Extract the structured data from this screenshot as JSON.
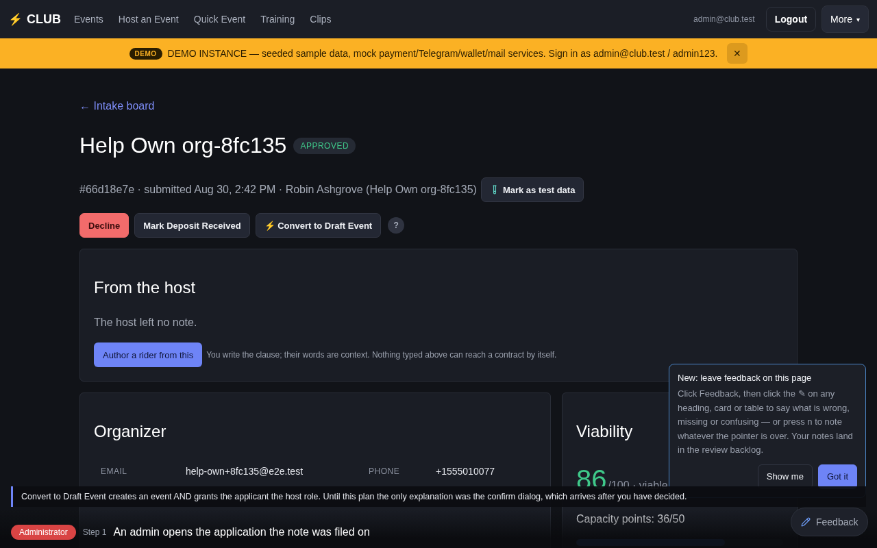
{
  "nav": {
    "brand_icon": "⚡",
    "brand": "CLUB",
    "links": [
      "Events",
      "Host an Event",
      "Quick Event",
      "Training",
      "Clips"
    ],
    "user": "admin@club.test",
    "logout": "Logout",
    "more": {
      "label": "More",
      "caret": "▾"
    }
  },
  "banner": {
    "badge": "DEMO",
    "text": "DEMO INSTANCE — seeded sample data, mock payment/Telegram/wallet/mail services. Sign in as admin@club.test / admin123.",
    "close": "✕"
  },
  "back_link": "← Intake board",
  "title": "Help Own org-8fc135",
  "status": "APPROVED",
  "meta": "#66d18e7e · submitted Aug 30, 2:42 PM · Robin Ashgrove (Help Own org-8fc135)",
  "test_button": "Mark as test data",
  "actions": [
    {
      "label": "Decline",
      "kind": "danger"
    },
    {
      "label": "Mark Deposit Received",
      "kind": "default"
    },
    {
      "label": "⚡ Convert to Draft Event",
      "kind": "default"
    }
  ],
  "help": "?",
  "host_card": {
    "title": "From the host",
    "note": "The host left no note.",
    "button": "Author a rider from this",
    "hint": "You write the clause; their words are context. Nothing typed above can reach a contract by itself."
  },
  "organizer": {
    "title": "Organizer",
    "fields": [
      {
        "label": "EMAIL",
        "value": "help-own+8fc135@e2e.test"
      },
      {
        "label": "PHONE",
        "value": "+1555010077"
      }
    ]
  },
  "viability": {
    "title": "Viability",
    "score": "86",
    "score_suffix": "/100 · viable",
    "capacity": "Capacity points: 36/50",
    "level": 0.72
  },
  "popover": {
    "title": "New: leave feedback on this page",
    "body": "Click Feedback, then click the ✎ on any heading, card or table to say what is wrong, missing or confusing — or press n to note whatever the pointer is over. Your notes land in the review backlog.",
    "buttons": [
      {
        "label": "Show me",
        "kind": "secondary"
      },
      {
        "label": "Got it",
        "kind": "primary"
      }
    ]
  },
  "caption": "Convert to Draft Event creates an event AND grants the applicant the host role. Until this plan the only explanation was the confirm dialog, which arrives after you have decided.",
  "step_bar": {
    "role": "Administrator",
    "step": "Step 1",
    "text": "An admin opens the application the note was filed on"
  },
  "feedback_button": "Feedback"
}
